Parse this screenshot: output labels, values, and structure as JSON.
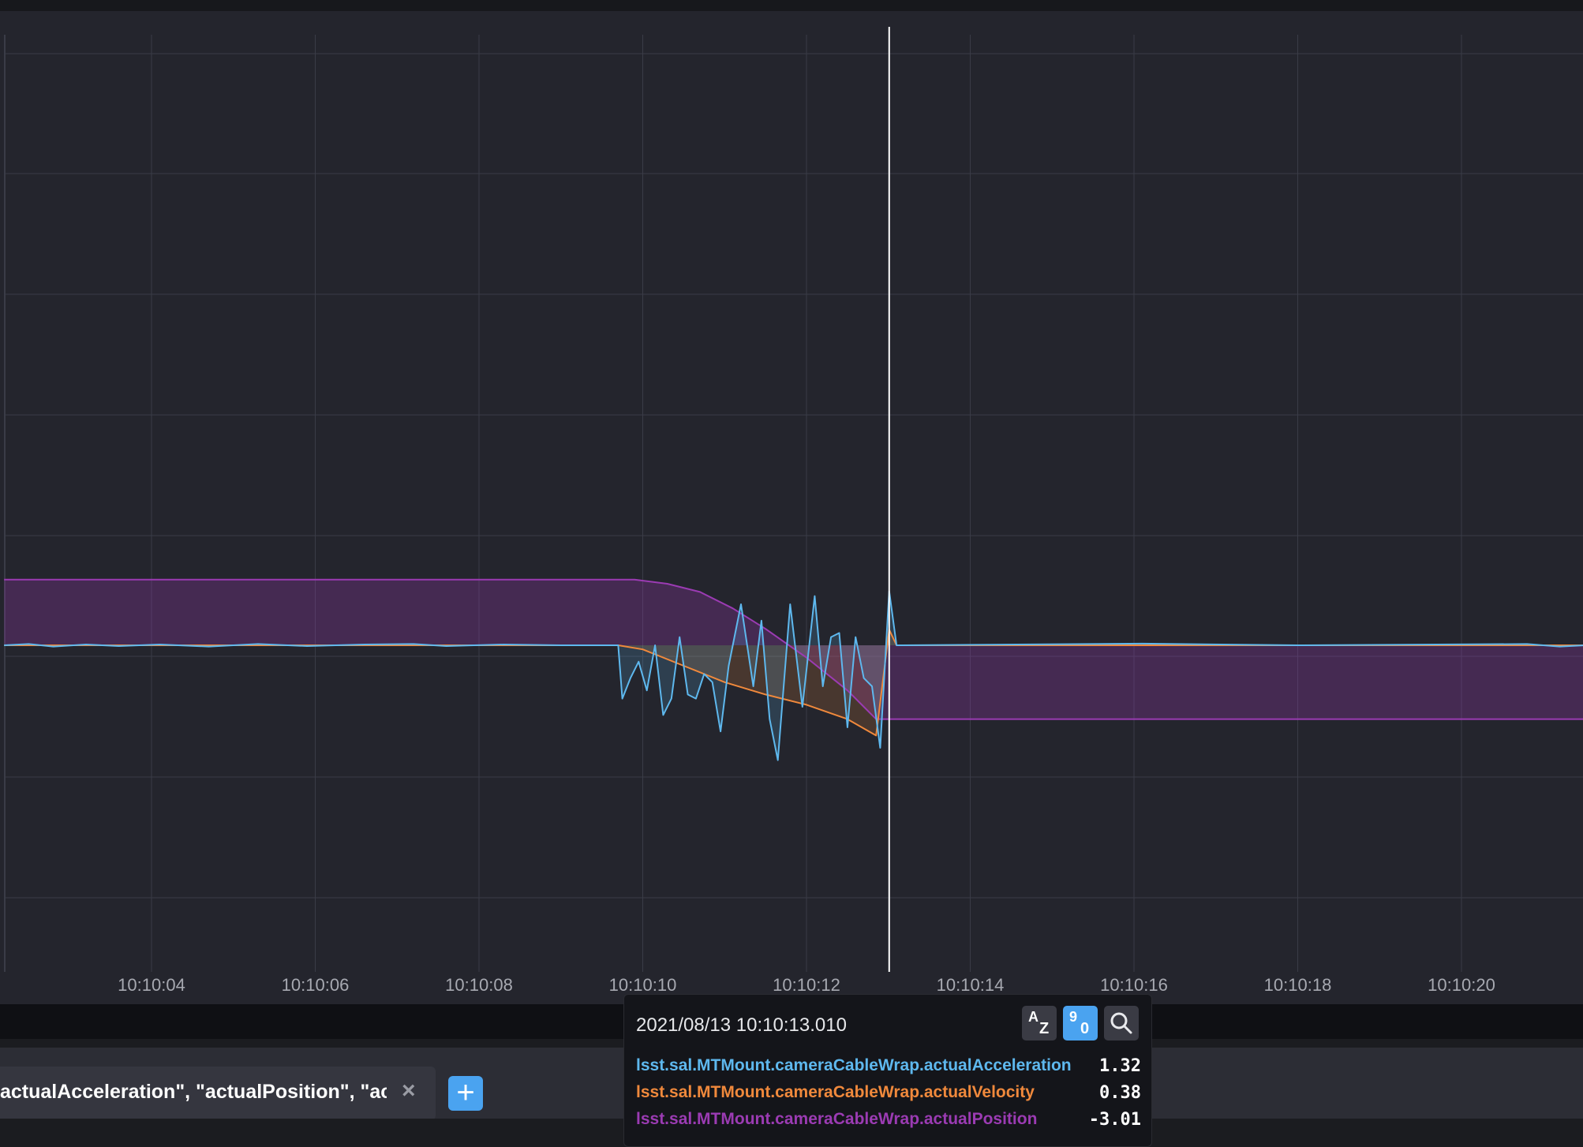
{
  "chart_data": {
    "type": "line",
    "x_ticks": [
      "10:10:04",
      "10:10:06",
      "10:10:08",
      "10:10:10",
      "10:10:12",
      "10:10:14",
      "10:10:16",
      "10:10:18",
      "10:10:20"
    ],
    "grid": true,
    "fill": "area-to-zero",
    "cursor_time": "10:10:13.010",
    "series": [
      {
        "name": "lsst.sal.MTMount.cameraCableWrap.actualAcceleration",
        "color": "#5eb8ee",
        "points": [
          {
            "t": "10:10:02.2",
            "v": 0
          },
          {
            "t": "10:10:02.5",
            "v": 0.03
          },
          {
            "t": "10:10:02.8",
            "v": -0.03
          },
          {
            "t": "10:10:03.2",
            "v": 0.02
          },
          {
            "t": "10:10:03.6",
            "v": -0.02
          },
          {
            "t": "10:10:04.1",
            "v": 0.02
          },
          {
            "t": "10:10:04.7",
            "v": -0.03
          },
          {
            "t": "10:10:05.3",
            "v": 0.03
          },
          {
            "t": "10:10:05.9",
            "v": -0.02
          },
          {
            "t": "10:10:06.6",
            "v": 0.02
          },
          {
            "t": "10:10:07.2",
            "v": 0.03
          },
          {
            "t": "10:10:07.6",
            "v": -0.02
          },
          {
            "t": "10:10:08.3",
            "v": 0.02
          },
          {
            "t": "10:10:09.0",
            "v": 0
          },
          {
            "t": "10:10:09.7",
            "v": 0
          },
          {
            "t": "10:10:09.75",
            "v": -1.3
          },
          {
            "t": "10:10:09.85",
            "v": -0.8
          },
          {
            "t": "10:10:09.95",
            "v": -0.4
          },
          {
            "t": "10:10:10.05",
            "v": -1.1
          },
          {
            "t": "10:10:10.15",
            "v": 0
          },
          {
            "t": "10:10:10.25",
            "v": -1.7
          },
          {
            "t": "10:10:10.35",
            "v": -1.3
          },
          {
            "t": "10:10:10.45",
            "v": 0.2
          },
          {
            "t": "10:10:10.55",
            "v": -1.2
          },
          {
            "t": "10:10:10.65",
            "v": -1.3
          },
          {
            "t": "10:10:10.75",
            "v": -0.7
          },
          {
            "t": "10:10:10.85",
            "v": -0.9
          },
          {
            "t": "10:10:10.95",
            "v": -2.1
          },
          {
            "t": "10:10:11.05",
            "v": -0.5
          },
          {
            "t": "10:10:11.2",
            "v": 1.0
          },
          {
            "t": "10:10:11.35",
            "v": -1.0
          },
          {
            "t": "10:10:11.45",
            "v": 0.6
          },
          {
            "t": "10:10:11.55",
            "v": -1.8
          },
          {
            "t": "10:10:11.65",
            "v": -2.8
          },
          {
            "t": "10:10:11.8",
            "v": 1.0
          },
          {
            "t": "10:10:11.95",
            "v": -1.5
          },
          {
            "t": "10:10:12.1",
            "v": 1.2
          },
          {
            "t": "10:10:12.2",
            "v": -1.0
          },
          {
            "t": "10:10:12.3",
            "v": 0.2
          },
          {
            "t": "10:10:12.4",
            "v": 0.3
          },
          {
            "t": "10:10:12.5",
            "v": -2.0
          },
          {
            "t": "10:10:12.6",
            "v": 0.2
          },
          {
            "t": "10:10:12.7",
            "v": -0.8
          },
          {
            "t": "10:10:12.8",
            "v": -1.0
          },
          {
            "t": "10:10:12.9",
            "v": -2.5
          },
          {
            "t": "10:10:13.01",
            "v": 1.32
          },
          {
            "t": "10:10:13.1",
            "v": 0
          },
          {
            "t": "10:10:16.1",
            "v": 0.04
          },
          {
            "t": "10:10:18",
            "v": 0
          },
          {
            "t": "10:10:20.8",
            "v": 0.03
          },
          {
            "t": "10:10:21.2",
            "v": -0.03
          },
          {
            "t": "10:10:21.5",
            "v": 0
          }
        ]
      },
      {
        "name": "lsst.sal.MTMount.cameraCableWrap.actualVelocity",
        "color": "#f0893c",
        "points": [
          {
            "t": "10:10:02.2",
            "v": 0
          },
          {
            "t": "10:10:09.7",
            "v": 0
          },
          {
            "t": "10:10:10.0",
            "v": -0.1
          },
          {
            "t": "10:10:10.5",
            "v": -0.5
          },
          {
            "t": "10:10:11.0",
            "v": -0.9
          },
          {
            "t": "10:10:11.5",
            "v": -1.2
          },
          {
            "t": "10:10:12.0",
            "v": -1.45
          },
          {
            "t": "10:10:12.5",
            "v": -1.8
          },
          {
            "t": "10:10:12.85",
            "v": -2.2
          },
          {
            "t": "10:10:13.01",
            "v": 0.38
          },
          {
            "t": "10:10:13.1",
            "v": 0
          },
          {
            "t": "10:10:21.5",
            "v": 0
          }
        ]
      },
      {
        "name": "lsst.sal.MTMount.cameraCableWrap.actualPosition",
        "color": "#9b3bb3",
        "points": [
          {
            "t": "10:10:02.2",
            "v": 1.6
          },
          {
            "t": "10:10:09.9",
            "v": 1.6
          },
          {
            "t": "10:10:10.3",
            "v": 1.5
          },
          {
            "t": "10:10:10.7",
            "v": 1.3
          },
          {
            "t": "10:10:11.1",
            "v": 0.9
          },
          {
            "t": "10:10:11.5",
            "v": 0.4
          },
          {
            "t": "10:10:12.0",
            "v": -0.3
          },
          {
            "t": "10:10:12.5",
            "v": -1.1
          },
          {
            "t": "10:10:12.85",
            "v": -1.8
          },
          {
            "t": "10:10:13.05",
            "v": -1.8
          },
          {
            "t": "10:10:21.5",
            "v": -1.8
          }
        ]
      }
    ]
  },
  "tooltip": {
    "timestamp": "2021/08/13 10:10:13.010",
    "sort_alpha_top": "A",
    "sort_alpha_bottom": "Z",
    "sort_numeric_top": "9",
    "sort_numeric_bottom": "0",
    "search_icon": "magnifier-icon",
    "rows": [
      {
        "name": "lsst.sal.MTMount.cameraCableWrap.actualAcceleration",
        "value": "1.32",
        "color": "#5eb8ee"
      },
      {
        "name": "lsst.sal.MTMount.cameraCableWrap.actualVelocity",
        "value": "0.38",
        "color": "#f0893c"
      },
      {
        "name": "lsst.sal.MTMount.cameraCableWrap.actualPosition",
        "value": "-3.01",
        "color": "#9b3bb3"
      }
    ]
  },
  "query": {
    "tab_text": "actualAcceleration\", \"actualPosition\", \"ac...",
    "close_label": "×",
    "add_label": "+"
  },
  "colors": {
    "background": "#24252d",
    "grid": "#3a3c47",
    "cursor": "#ffffff",
    "accent": "#4aa3f0"
  }
}
